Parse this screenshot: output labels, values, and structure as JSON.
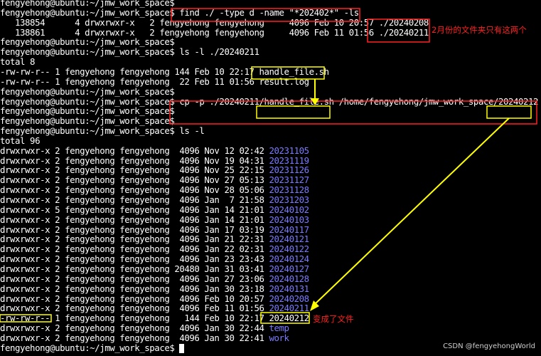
{
  "terminal": {
    "prompt": "fengyehong@ubuntu:~/jmw_work_space$",
    "lines": [
      {
        "segments": [
          {
            "text": "fengyehong@ubuntu:~/jmw_work_space$"
          }
        ]
      },
      {
        "segments": [
          {
            "text": "fengyehong@ubuntu:~/jmw_work_space$ find ./ -type d -name \"*202402*\" -ls"
          }
        ]
      },
      {
        "segments": [
          {
            "text": "   138854      4 drwxrwxr-x   2 fengyehong fengyehong     4096 Feb 10 20:57 ./20240208"
          }
        ]
      },
      {
        "segments": [
          {
            "text": "   138861      4 drwxrwxr-x   2 fengyehong fengyehong     4096 Feb 11 01:56 ./20240211"
          }
        ]
      },
      {
        "segments": [
          {
            "text": "fengyehong@ubuntu:~/jmw_work_space$"
          }
        ]
      },
      {
        "segments": [
          {
            "text": "fengyehong@ubuntu:~/jmw_work_space$ ls -l ./20240211"
          }
        ]
      },
      {
        "segments": [
          {
            "text": "total 8"
          }
        ]
      },
      {
        "segments": [
          {
            "text": "-rw-rw-r-- 1 fengyehong fengyehong 144 Feb 10 22:17 handle_file.sh"
          }
        ]
      },
      {
        "segments": [
          {
            "text": "-rw-rw-r-- 1 fengyehong fengyehong  22 Feb 11 01:56 result.log"
          }
        ]
      },
      {
        "segments": [
          {
            "text": "fengyehong@ubuntu:~/jmw_work_space$"
          }
        ]
      },
      {
        "segments": [
          {
            "text": "fengyehong@ubuntu:~/jmw_work_space$ cp -p ./20240211/handle_file.sh /home/fengyehong/jmw_work_space/20240212"
          }
        ]
      },
      {
        "segments": [
          {
            "text": "fengyehong@ubuntu:~/jmw_work_space$"
          }
        ]
      },
      {
        "segments": [
          {
            "text": "fengyehong@ubuntu:~/jmw_work_space$"
          }
        ]
      },
      {
        "segments": [
          {
            "text": "fengyehong@ubuntu:~/jmw_work_space$ ls -l"
          }
        ]
      },
      {
        "segments": [
          {
            "text": "total 96"
          }
        ]
      },
      {
        "segments": [
          {
            "text": "drwxrwxr-x 2 fengyehong fengyehong  4096 Nov 12 02:42 "
          },
          {
            "text": "20231105",
            "style": "dir"
          }
        ]
      },
      {
        "segments": [
          {
            "text": "drwxrwxr-x 2 fengyehong fengyehong  4096 Nov 19 04:31 "
          },
          {
            "text": "20231119",
            "style": "dir"
          }
        ]
      },
      {
        "segments": [
          {
            "text": "drwxrwxr-x 2 fengyehong fengyehong  4096 Nov 25 22:15 "
          },
          {
            "text": "20231126",
            "style": "dir"
          }
        ]
      },
      {
        "segments": [
          {
            "text": "drwxrwxr-x 2 fengyehong fengyehong  4096 Nov 27 05:13 "
          },
          {
            "text": "20231127",
            "style": "dir"
          }
        ]
      },
      {
        "segments": [
          {
            "text": "drwxrwxr-x 2 fengyehong fengyehong  4096 Nov 28 05:06 "
          },
          {
            "text": "20231128",
            "style": "dir"
          }
        ]
      },
      {
        "segments": [
          {
            "text": "drwxrwxr-x 2 fengyehong fengyehong  4096 Jan  7 21:58 "
          },
          {
            "text": "20231203",
            "style": "dir"
          }
        ]
      },
      {
        "segments": [
          {
            "text": "drwxrwxr-x 5 fengyehong fengyehong  4096 Jan 14 21:01 "
          },
          {
            "text": "20240102",
            "style": "dir"
          }
        ]
      },
      {
        "segments": [
          {
            "text": "drwxrwxr-x 2 fengyehong fengyehong  4096 Jan 14 21:01 "
          },
          {
            "text": "20240103",
            "style": "dir"
          }
        ]
      },
      {
        "segments": [
          {
            "text": "drwxrwxr-x 2 fengyehong fengyehong  4096 Jan 17 03:19 "
          },
          {
            "text": "20240117",
            "style": "dir"
          }
        ]
      },
      {
        "segments": [
          {
            "text": "drwxrwxr-x 2 fengyehong fengyehong  4096 Jan 21 22:31 "
          },
          {
            "text": "20240121",
            "style": "dir"
          }
        ]
      },
      {
        "segments": [
          {
            "text": "drwxrwxr-x 2 fengyehong fengyehong  4096 Jan 22 02:31 "
          },
          {
            "text": "20240122",
            "style": "dir"
          }
        ]
      },
      {
        "segments": [
          {
            "text": "drwxrwxr-x 2 fengyehong fengyehong  4096 Jan 23 23:43 "
          },
          {
            "text": "20240124",
            "style": "dir"
          }
        ]
      },
      {
        "segments": [
          {
            "text": "drwxrwxr-x 2 fengyehong fengyehong 20480 Jan 31 03:41 "
          },
          {
            "text": "20240127",
            "style": "dir"
          }
        ]
      },
      {
        "segments": [
          {
            "text": "drwxrwxr-x 2 fengyehong fengyehong  4096 Jan 27 23:06 "
          },
          {
            "text": "20240128",
            "style": "dir"
          }
        ]
      },
      {
        "segments": [
          {
            "text": "drwxrwxr-x 2 fengyehong fengyehong  4096 Jan 30 23:18 "
          },
          {
            "text": "20240131",
            "style": "dir"
          }
        ]
      },
      {
        "segments": [
          {
            "text": "drwxrwxr-x 2 fengyehong fengyehong  4096 Feb 10 20:57 "
          },
          {
            "text": "20240208",
            "style": "dir"
          }
        ]
      },
      {
        "segments": [
          {
            "text": "drwxrwxr-x 2 fengyehong fengyehong  4096 Feb 11 01:56 "
          },
          {
            "text": "20240211",
            "style": "dir"
          }
        ]
      },
      {
        "segments": [
          {
            "text": "-rw-rw-r-- 1 fengyehong fengyehong   144 Feb 10 22:17 20240212"
          }
        ]
      },
      {
        "segments": [
          {
            "text": "drwxrwxr-x 2 fengyehong fengyehong  4096 Jan 30 22:44 "
          },
          {
            "text": "temp",
            "style": "dir"
          }
        ]
      },
      {
        "segments": [
          {
            "text": "drwxrwxr-x 2 fengyehong fengyehong  4096 Jan 30 22:41 "
          },
          {
            "text": "work",
            "style": "dir"
          }
        ]
      },
      {
        "segments": [
          {
            "text": "fengyehong@ubuntu:~/jmw_work_space$ "
          },
          {
            "style": "cursor"
          }
        ]
      }
    ]
  },
  "annotations": {
    "note_dirs": "2月份的文件夹只有这两个",
    "note_became_file": "变成了文件",
    "red_color": "#ff2020",
    "yellow_color": "#ffff00"
  },
  "watermark": "CSDN @fengyehongWorld"
}
